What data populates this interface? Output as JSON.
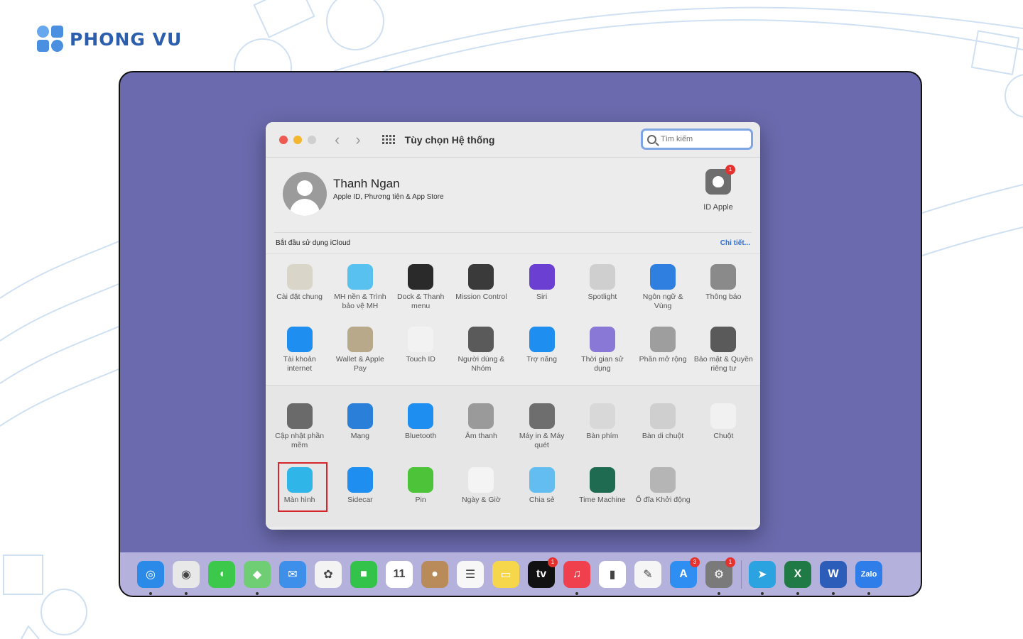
{
  "brand": {
    "name": "PHONG VU"
  },
  "window": {
    "title": "Tùy chọn Hệ thống",
    "search_placeholder": "Tìm kiếm"
  },
  "profile": {
    "name": "Thanh Ngan",
    "subtitle": "Apple ID, Phương tiện & App Store",
    "apple_id_label": "ID Apple",
    "apple_id_badge": "1"
  },
  "icloud": {
    "text": "Bắt đầu sử dụng iCloud",
    "link": "Chi tiết..."
  },
  "panes_section1": [
    {
      "name": "general",
      "label": "Cài đặt chung",
      "icon": "general-icon",
      "color": "#d9d6c9"
    },
    {
      "name": "desktop-screensaver",
      "label": "MH nền & Trình bảo vệ MH",
      "icon": "desktop-icon",
      "color": "#59c1ef"
    },
    {
      "name": "dock-menu",
      "label": "Dock & Thanh menu",
      "icon": "dock-icon",
      "color": "#2a2a2a"
    },
    {
      "name": "mission-control",
      "label": "Mission Control",
      "icon": "mission-control-icon",
      "color": "#3a3a3a"
    },
    {
      "name": "siri",
      "label": "Siri",
      "icon": "siri-icon",
      "color": "#6a3fd1"
    },
    {
      "name": "spotlight",
      "label": "Spotlight",
      "icon": "spotlight-icon",
      "color": "#cfcfcf"
    },
    {
      "name": "language-region",
      "label": "Ngôn ngữ & Vùng",
      "icon": "flag-icon",
      "color": "#2f7fe0"
    },
    {
      "name": "notifications",
      "label": "Thông báo",
      "icon": "bell-icon",
      "color": "#8a8a8a"
    },
    {
      "name": "internet-accounts",
      "label": "Tài khoản internet",
      "icon": "at-icon",
      "color": "#1f8ef1"
    },
    {
      "name": "wallet-applepay",
      "label": "Wallet & Apple Pay",
      "icon": "wallet-icon",
      "color": "#b8a98a"
    },
    {
      "name": "touch-id",
      "label": "Touch ID",
      "icon": "fingerprint-icon",
      "color": "#f2f2f2"
    },
    {
      "name": "users-groups",
      "label": "Người dùng & Nhóm",
      "icon": "users-icon",
      "color": "#5a5a5a"
    },
    {
      "name": "accessibility",
      "label": "Trợ năng",
      "icon": "accessibility-icon",
      "color": "#1f8ef1"
    },
    {
      "name": "screen-time",
      "label": "Thời gian sử dụng",
      "icon": "hourglass-icon",
      "color": "#8a78d6"
    },
    {
      "name": "extensions",
      "label": "Phần mở rộng",
      "icon": "puzzle-icon",
      "color": "#9e9e9e"
    },
    {
      "name": "security-privacy",
      "label": "Bảo mật & Quyền riêng tư",
      "icon": "house-lock-icon",
      "color": "#5a5a5a"
    }
  ],
  "panes_section2": [
    {
      "name": "software-update",
      "label": "Cập nhật phần mềm",
      "icon": "gear-icon",
      "color": "#6a6a6a"
    },
    {
      "name": "network",
      "label": "Mạng",
      "icon": "globe-icon",
      "color": "#2a7fd8"
    },
    {
      "name": "bluetooth",
      "label": "Bluetooth",
      "icon": "bluetooth-icon",
      "color": "#1f8ef1"
    },
    {
      "name": "sound",
      "label": "Âm thanh",
      "icon": "speaker-icon",
      "color": "#9a9a9a"
    },
    {
      "name": "printers-scanners",
      "label": "Máy in & Máy quét",
      "icon": "printer-icon",
      "color": "#6e6e6e"
    },
    {
      "name": "keyboard",
      "label": "Bàn phím",
      "icon": "keyboard-icon",
      "color": "#d8d8d8"
    },
    {
      "name": "trackpad",
      "label": "Bàn di chuột",
      "icon": "trackpad-icon",
      "color": "#cfcfcf"
    },
    {
      "name": "mouse",
      "label": "Chuột",
      "icon": "mouse-icon",
      "color": "#f1f1f1"
    },
    {
      "name": "displays",
      "label": "Màn hình",
      "icon": "display-icon",
      "color": "#30b5e8"
    },
    {
      "name": "sidecar",
      "label": "Sidecar",
      "icon": "sidecar-icon",
      "color": "#1f8ef1"
    },
    {
      "name": "battery",
      "label": "Pin",
      "icon": "battery-icon",
      "color": "#4cc338"
    },
    {
      "name": "date-time",
      "label": "Ngày & Giờ",
      "icon": "clock-icon",
      "color": "#f4f4f4"
    },
    {
      "name": "sharing",
      "label": "Chia sẻ",
      "icon": "folder-icon",
      "color": "#63bdf0"
    },
    {
      "name": "time-machine",
      "label": "Time Machine",
      "icon": "time-machine-icon",
      "color": "#1e6b52"
    },
    {
      "name": "startup-disk",
      "label": "Ổ đĩa Khởi động",
      "icon": "disk-icon",
      "color": "#b5b5b5"
    }
  ],
  "dock": [
    {
      "name": "safari",
      "icon": "safari-icon",
      "color": "#2b8ae8",
      "glyph": "◎",
      "running": true
    },
    {
      "name": "chrome",
      "icon": "chrome-icon",
      "color": "#e8e8e8",
      "glyph": "◉",
      "running": true
    },
    {
      "name": "messages",
      "icon": "messages-icon",
      "color": "#3cc84b",
      "glyph": "◖",
      "running": false
    },
    {
      "name": "maps",
      "icon": "maps-icon",
      "color": "#6fce73",
      "glyph": "◆",
      "running": true
    },
    {
      "name": "mail",
      "icon": "mail-icon",
      "color": "#3d8fe9",
      "glyph": "✉",
      "running": false
    },
    {
      "name": "photos",
      "icon": "photos-icon",
      "color": "#f3f3f3",
      "glyph": "✿",
      "running": false
    },
    {
      "name": "facetime",
      "icon": "facetime-icon",
      "color": "#33c24a",
      "glyph": "■",
      "running": false
    },
    {
      "name": "calendar",
      "icon": "calendar-icon",
      "color": "#ffffff",
      "glyph": "11",
      "running": false
    },
    {
      "name": "contacts",
      "icon": "contacts-icon",
      "color": "#b98a5a",
      "glyph": "●",
      "running": false
    },
    {
      "name": "reminders",
      "icon": "reminders-icon",
      "color": "#f7f7f7",
      "glyph": "☰",
      "running": false
    },
    {
      "name": "notes",
      "icon": "notes-icon",
      "color": "#f6d64a",
      "glyph": "▭",
      "running": false
    },
    {
      "name": "apple-tv",
      "icon": "tv-icon",
      "color": "#111111",
      "glyph": "tv",
      "badge": "1",
      "running": false
    },
    {
      "name": "music",
      "icon": "music-icon",
      "color": "#f0404e",
      "glyph": "♫",
      "running": true
    },
    {
      "name": "numbers",
      "icon": "numbers-icon",
      "color": "#ffffff",
      "glyph": "▮",
      "running": false
    },
    {
      "name": "pages",
      "icon": "pages-icon",
      "color": "#f5f5f5",
      "glyph": "✎",
      "running": false
    },
    {
      "name": "app-store",
      "icon": "app-store-icon",
      "color": "#2f8ef2",
      "glyph": "A",
      "badge": "3",
      "running": false
    },
    {
      "name": "system-preferences",
      "icon": "gear-icon",
      "color": "#7a7a7a",
      "glyph": "⚙",
      "badge": "1",
      "running": true
    },
    {
      "name": "telegram",
      "icon": "telegram-icon",
      "color": "#2aa3e0",
      "glyph": "➤",
      "running": true
    },
    {
      "name": "excel",
      "icon": "excel-icon",
      "color": "#1f7a45",
      "glyph": "X",
      "running": true
    },
    {
      "name": "word",
      "icon": "word-icon",
      "color": "#2b5db9",
      "glyph": "W",
      "running": true
    },
    {
      "name": "zalo",
      "icon": "zalo-icon",
      "color": "#2f7de8",
      "glyph": "Zalo",
      "running": true
    }
  ]
}
